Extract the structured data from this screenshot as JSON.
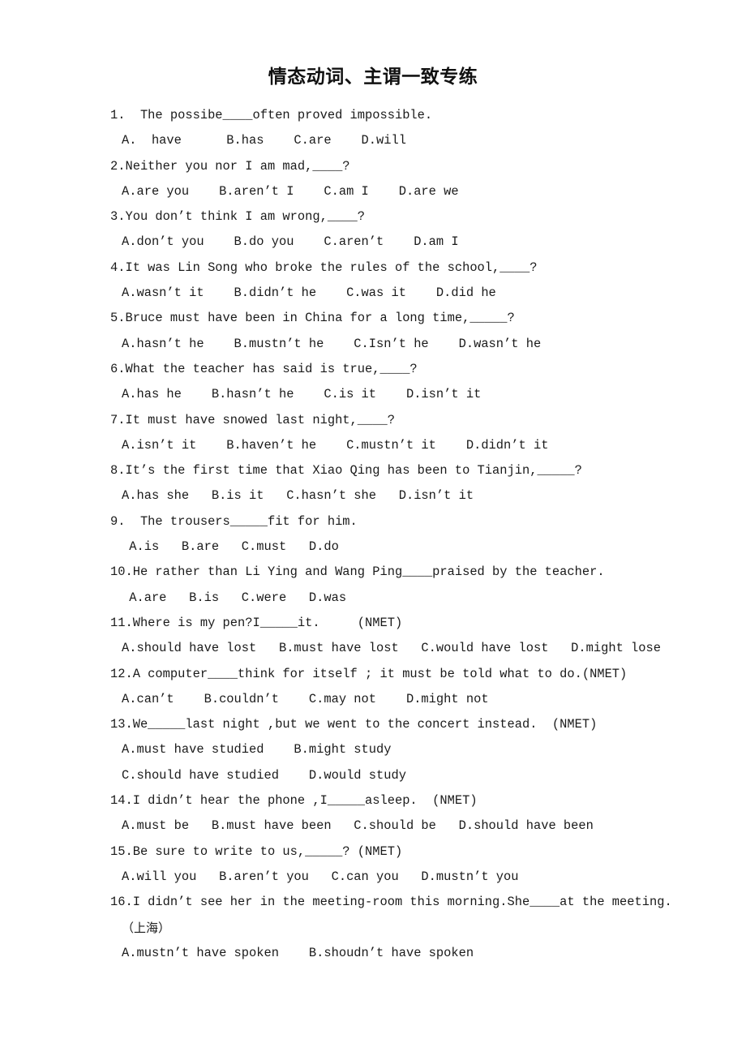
{
  "document": {
    "title": "情态动词、主谓一致专练",
    "page_background": "#ffffff",
    "text_color": "#1a1a1a"
  },
  "questions": [
    {
      "number": "1.",
      "stem_before": "1.  The possibe",
      "blank": "____",
      "stem_after": "often proved impossible.",
      "stem_full": "1.  The possibe____often proved impossible.",
      "options_lines": [
        "A.  have      B.has    C.are    D.will"
      ],
      "options": [
        "A.  have",
        "B.has",
        "C.are",
        "D.will"
      ]
    },
    {
      "number": "2.",
      "stem_full": "2.Neither you nor I am mad,____?",
      "options_lines": [
        "A.are you    B.aren’t I    C.am I    D.are we"
      ],
      "options": [
        "A.are you",
        "B.aren’t I",
        "C.am I",
        "D.are we"
      ]
    },
    {
      "number": "3.",
      "stem_full": "3.You don’t think I am wrong,____?",
      "options_lines": [
        "A.don’t you    B.do you    C.aren’t    D.am I"
      ],
      "options": [
        "A.don’t you",
        "B.do you",
        "C.aren’t",
        "D.am I"
      ]
    },
    {
      "number": "4.",
      "stem_full": "4.It was Lin Song who broke the rules of the school,____?",
      "options_lines": [
        "A.wasn’t it    B.didn’t he    C.was it    D.did he"
      ],
      "options": [
        "A.wasn’t it",
        "B.didn’t he",
        "C.was it",
        "D.did he"
      ]
    },
    {
      "number": "5.",
      "stem_full": "5.Bruce must have been in China for a long time,_____?",
      "options_lines": [
        "A.hasn’t he    B.mustn’t he    C.Isn’t he    D.wasn’t he"
      ],
      "options": [
        "A.hasn’t he",
        "B.mustn’t he",
        "C.Isn’t he",
        "D.wasn’t he"
      ]
    },
    {
      "number": "6.",
      "stem_full": "6.What the teacher has said is true,____?",
      "options_lines": [
        "A.has he    B.hasn’t he    C.is it    D.isn’t it"
      ],
      "options": [
        "A.has he",
        "B.hasn’t he",
        "C.is it",
        "D.isn’t it"
      ]
    },
    {
      "number": "7.",
      "stem_full": "7.It must have snowed last night,____?",
      "options_lines": [
        "A.isn’t it    B.haven’t he    C.mustn’t it    D.didn’t it"
      ],
      "options": [
        "A.isn’t it",
        "B.haven’t he",
        "C.mustn’t it",
        "D.didn’t it"
      ]
    },
    {
      "number": "8.",
      "stem_full": "8.It’s the first time that Xiao Qing has been to Tianjin,_____?",
      "options_lines": [
        "A.has she   B.is it   C.hasn’t she   D.isn’t it"
      ],
      "options": [
        "A.has she",
        "B.is it",
        "C.hasn’t she",
        "D.isn’t it"
      ]
    },
    {
      "number": "9.",
      "stem_full": "9.  The trousers_____fit for him.",
      "options_lines": [
        " A.is   B.are   C.must   D.do"
      ],
      "options": [
        "A.is",
        "B.are",
        "C.must",
        "D.do"
      ]
    },
    {
      "number": "10.",
      "stem_full": "10.He rather than Li Ying and Wang Ping____praised by the teacher.",
      "options_lines": [
        " A.are   B.is   C.were   D.was"
      ],
      "options": [
        "A.are",
        "B.is",
        "C.were",
        "D.was"
      ]
    },
    {
      "number": "11.",
      "stem_full": "11.Where is my pen?I_____it.     (NMET)",
      "options_lines": [
        "A.should have lost   B.must have lost   C.would have lost   D.might lose"
      ],
      "options": [
        "A.should have lost",
        "B.must have lost",
        "C.would have lost",
        "D.might lose"
      ]
    },
    {
      "number": "12.",
      "stem_full": "12.A computer____think for itself ; it must be told what to do.(NMET)",
      "options_lines": [
        "A.can’t    B.couldn’t    C.may not    D.might not"
      ],
      "options": [
        "A.can’t",
        "B.couldn’t",
        "C.may not",
        "D.might not"
      ]
    },
    {
      "number": "13.",
      "stem_full": "13.We_____last night ,but we went to the concert instead.  (NMET)",
      "options_lines": [
        "A.must have studied    B.might study",
        "C.should have studied    D.would study"
      ],
      "options": [
        "A.must have studied",
        "B.might study",
        "C.should have studied",
        "D.would study"
      ]
    },
    {
      "number": "14.",
      "stem_full": "14.I didn’t hear the phone ,I_____asleep.  (NMET)",
      "options_lines": [
        "A.must be   B.must have been   C.should be   D.should have been"
      ],
      "options": [
        "A.must be",
        "B.must have been",
        "C.should be",
        "D.should have been"
      ]
    },
    {
      "number": "15.",
      "stem_full": "15.Be sure to write to us,_____? (NMET)",
      "options_lines": [
        "A.will you   B.aren’t you   C.can you   D.mustn’t you"
      ],
      "options": [
        "A.will you",
        "B.aren’t you",
        "C.can you",
        "D.mustn’t you"
      ]
    },
    {
      "number": "16.",
      "stem_full": "16.I didn’t see her in the meeting-room this morning.She____at the meeting.",
      "note": "（上海）",
      "options_lines": [
        "A.mustn’t have spoken    B.shoudn’t have spoken"
      ],
      "options": [
        "A.mustn’t have spoken",
        "B.shoudn’t have spoken"
      ]
    }
  ]
}
